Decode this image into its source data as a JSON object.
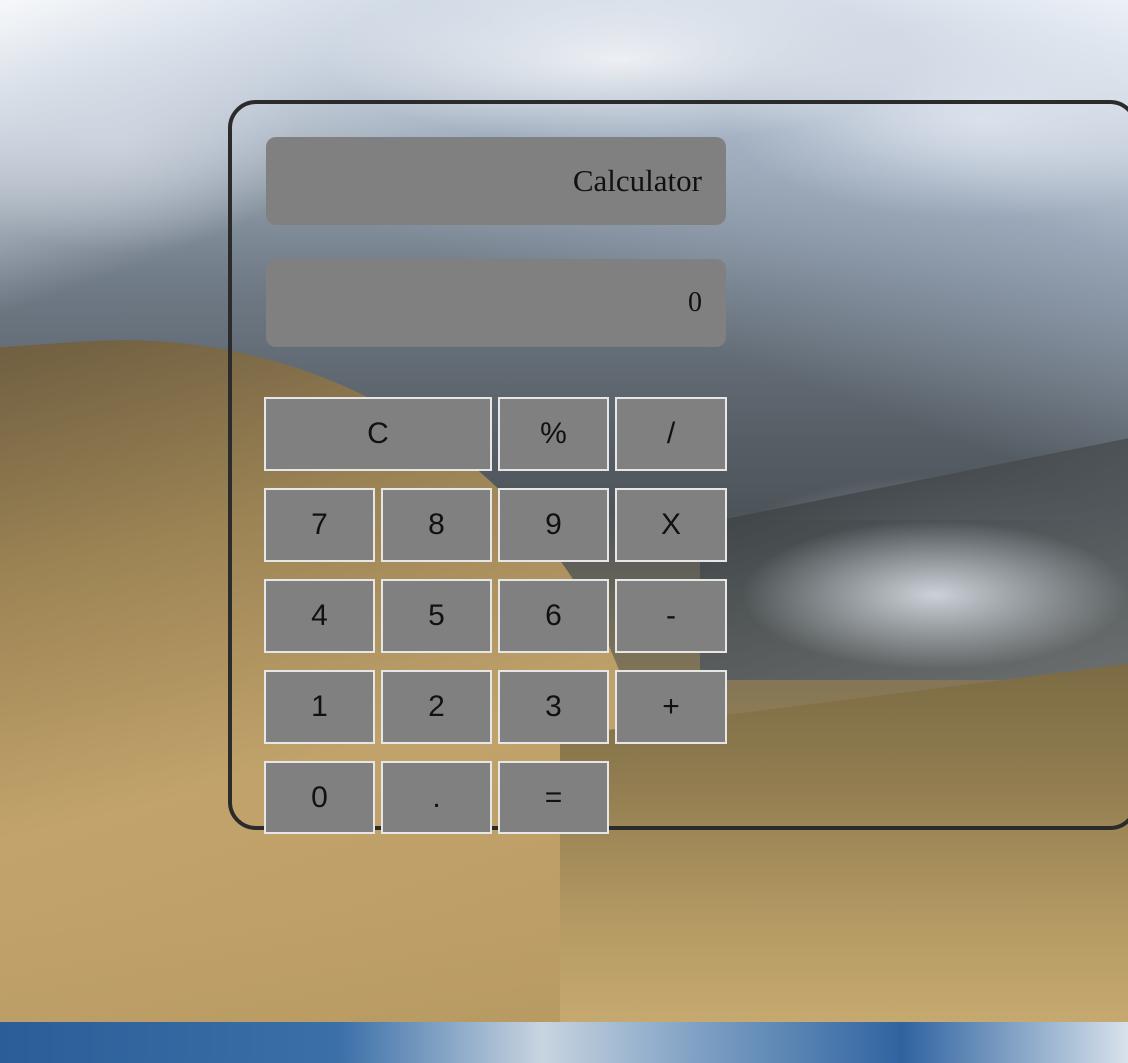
{
  "calculator": {
    "title": "Calculator",
    "display_value": "0",
    "keys": {
      "clear": "C",
      "percent": "%",
      "divide": "/",
      "seven": "7",
      "eight": "8",
      "nine": "9",
      "multiply": "X",
      "four": "4",
      "five": "5",
      "six": "6",
      "subtract": "-",
      "one": "1",
      "two": "2",
      "three": "3",
      "add": "+",
      "zero": "0",
      "decimal": ".",
      "equals": "="
    }
  },
  "colors": {
    "display_background": "#808080",
    "key_background": "#808080",
    "key_border": "#e6e6e6",
    "panel_border": "#2b2b2b"
  }
}
